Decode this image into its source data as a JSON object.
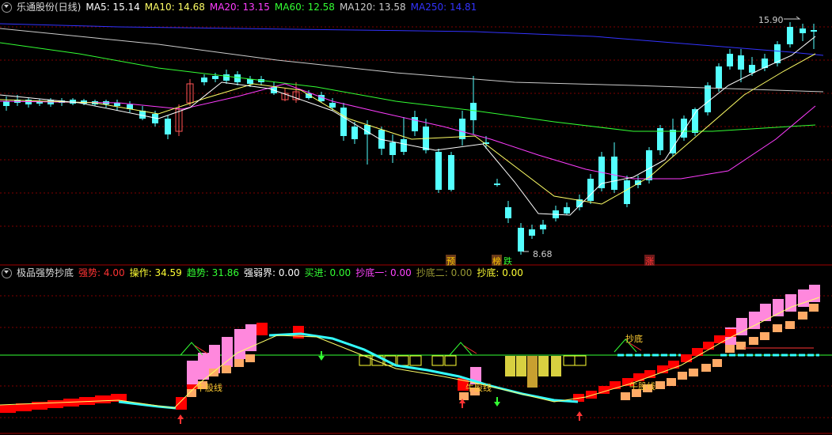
{
  "main": {
    "title": "乐通股份(日线)",
    "indicators": [
      {
        "label": "MA5: 15.14",
        "color": "#ffffff"
      },
      {
        "label": "MA10: 14.68",
        "color": "#ffff66"
      },
      {
        "label": "MA20: 13.15",
        "color": "#ff3dff"
      },
      {
        "label": "MA60: 12.58",
        "color": "#33ff33"
      },
      {
        "label": "MA120: 13.58",
        "color": "#cccccc"
      },
      {
        "label": "MA250: 14.81",
        "color": "#3333ff"
      }
    ],
    "high_label": "15.90",
    "low_label": "8.68",
    "tags": [
      {
        "text": "预",
        "color": "#ffcc00"
      },
      {
        "text": "榜",
        "color": "#ffcc00"
      },
      {
        "text": "跌",
        "color": "#33ff33"
      },
      {
        "text": "涨",
        "color": "#ff3333"
      }
    ]
  },
  "sub": {
    "title": "极品强势抄底",
    "indicators": [
      {
        "label": "强势: 4.00",
        "color": "#ff3333"
      },
      {
        "label": "操作: 34.59",
        "color": "#ffff33"
      },
      {
        "label": "趋势: 31.86",
        "color": "#33ff33"
      },
      {
        "label": "强弱界: 0.00",
        "color": "#ffffff"
      },
      {
        "label": "买进: 0.00",
        "color": "#33ff33"
      },
      {
        "label": "抄底一: 0.00",
        "color": "#ff44ff"
      },
      {
        "label": "抄底二: 0.00",
        "color": "#999933"
      },
      {
        "label": "抄底: 0.00",
        "color": "#ffff33"
      }
    ],
    "annotations": [
      {
        "text": "牛股线",
        "color": "#ffcc33"
      },
      {
        "text": "牛股线",
        "color": "#ffcc33"
      },
      {
        "text": "牛股线",
        "color": "#ffcc33"
      },
      {
        "text": "抄底",
        "color": "#ffcc33"
      }
    ]
  },
  "colors": {
    "up": "#ff5555",
    "down": "#54ffff",
    "grid": "#800000"
  }
}
